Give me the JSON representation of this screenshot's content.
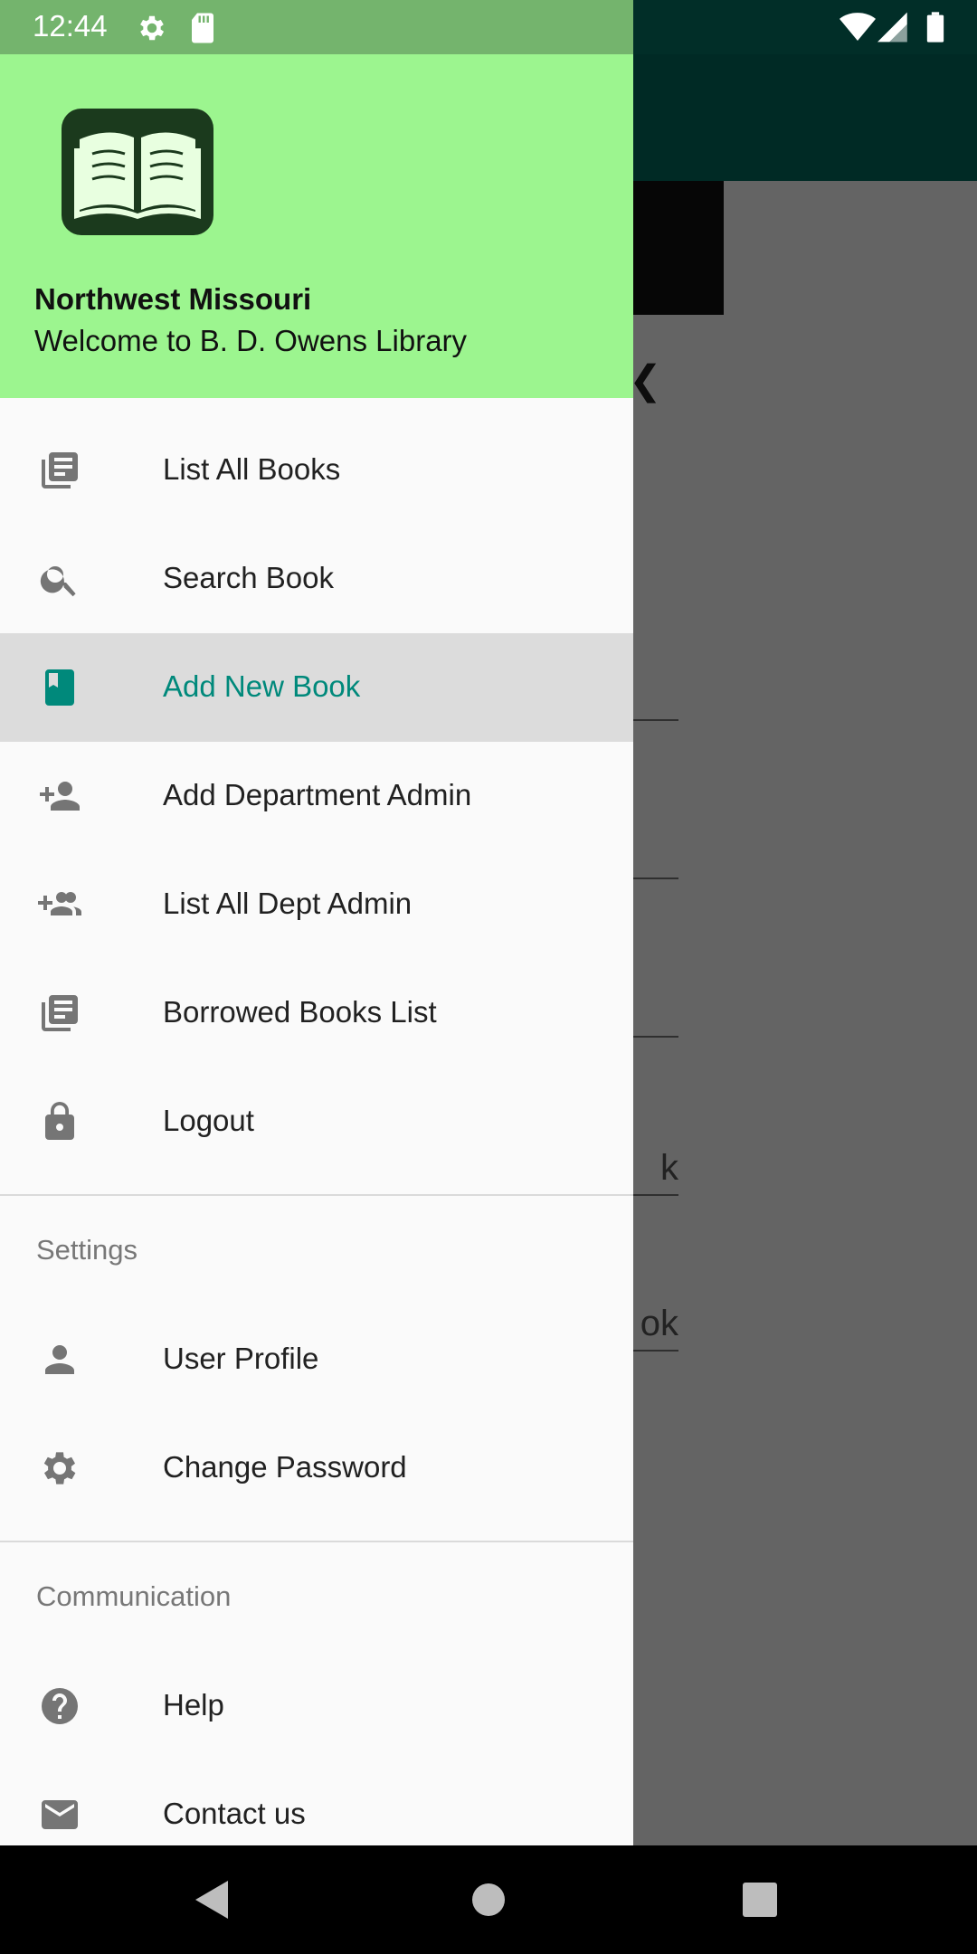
{
  "status_bar": {
    "time": "12:44"
  },
  "drawer": {
    "header": {
      "title": "Northwest Missouri",
      "subtitle": "Welcome to B. D. Owens Library",
      "logo_icon": "open-book-icon"
    },
    "menu": [
      {
        "label": "List All Books",
        "icon": "list-icon"
      },
      {
        "label": "Search Book",
        "icon": "search-icon"
      },
      {
        "label": "Add New Book",
        "icon": "book-icon",
        "selected": true
      },
      {
        "label": "Add Department Admin",
        "icon": "person-add-icon"
      },
      {
        "label": "List All Dept Admin",
        "icon": "group-add-icon"
      },
      {
        "label": "Borrowed Books List",
        "icon": "list-icon"
      },
      {
        "label": "Logout",
        "icon": "lock-icon"
      }
    ],
    "settings": {
      "title": "Settings",
      "items": [
        {
          "label": "User Profile",
          "icon": "person-icon"
        },
        {
          "label": "Change Password",
          "icon": "gear-icon"
        }
      ]
    },
    "communication": {
      "title": "Communication",
      "items": [
        {
          "label": "Help",
          "icon": "help-icon"
        },
        {
          "label": "Contact us",
          "icon": "mail-icon"
        }
      ]
    }
  },
  "background": {
    "field_texts": [
      "",
      "",
      "",
      "k",
      "ok",
      ""
    ]
  },
  "colors": {
    "drawer_header": "#9cf58f",
    "accent": "#00897b",
    "selected_bg": "#dcdcdc"
  }
}
